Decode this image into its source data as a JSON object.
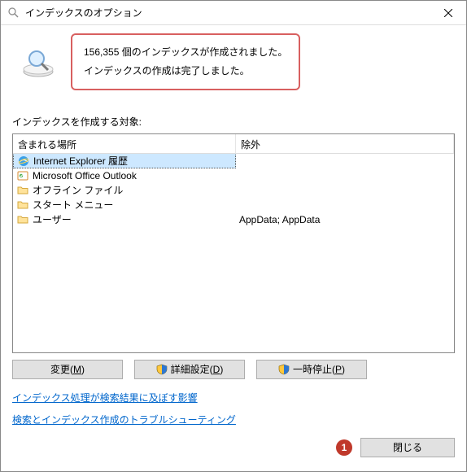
{
  "title": "インデックスのオプション",
  "status": {
    "line1": "156,355 個のインデックスが作成されました。",
    "line2": "インデックスの作成は完了しました。"
  },
  "section_label": "インデックスを作成する対象:",
  "columns": {
    "c0": "含まれる場所",
    "c1": "除外"
  },
  "rows": [
    {
      "icon": "ie",
      "label": "Internet Explorer 履歴",
      "exclude": "",
      "selected": true
    },
    {
      "icon": "outlook",
      "label": "Microsoft Office Outlook",
      "exclude": "",
      "selected": false
    },
    {
      "icon": "folder",
      "label": "オフライン ファイル",
      "exclude": "",
      "selected": false
    },
    {
      "icon": "folder",
      "label": "スタート メニュー",
      "exclude": "",
      "selected": false
    },
    {
      "icon": "folder",
      "label": "ユーザー",
      "exclude": "AppData; AppData",
      "selected": false
    }
  ],
  "buttons": {
    "modify": "変更",
    "modify_key": "M",
    "advanced": "詳細設定",
    "advanced_key": "D",
    "pause": "一時停止",
    "pause_key": "P"
  },
  "links": {
    "l1": "インデックス処理が検索結果に及ぼす影響",
    "l2": "検索とインデックス作成のトラブルシューティング"
  },
  "badge": "1",
  "close_btn": "閉じる"
}
